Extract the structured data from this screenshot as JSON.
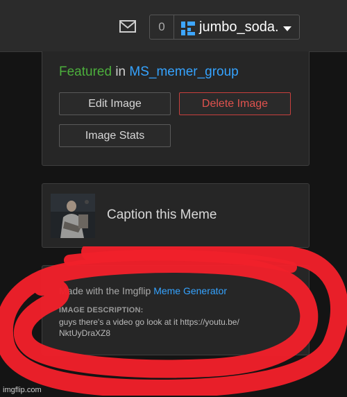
{
  "header": {
    "notification_count": "0",
    "username": "jumbo_soda.",
    "icons": {
      "mail": "mail-icon",
      "dropdown": "caret-down-icon"
    }
  },
  "image_panel": {
    "featured_label": "Featured",
    "in_label": "in",
    "stream_name": "MS_memer_group",
    "edit_button": "Edit Image",
    "delete_button": "Delete Image",
    "stats_button": "Image Stats"
  },
  "caption_panel": {
    "label": "Caption this Meme"
  },
  "description_panel": {
    "made_with_prefix": "Made with the Imgflip",
    "made_with_link": "Meme Generator",
    "description_heading": "IMAGE DESCRIPTION:",
    "description_text": "guys there's a video go look at it https://youtu.be/ NktUyDraXZ8"
  },
  "watermark": "imgflip.com",
  "colors": {
    "featured": "#4caf3c",
    "link": "#35a3ff",
    "delete": "#e0524e",
    "scribble": "#f0202a"
  }
}
